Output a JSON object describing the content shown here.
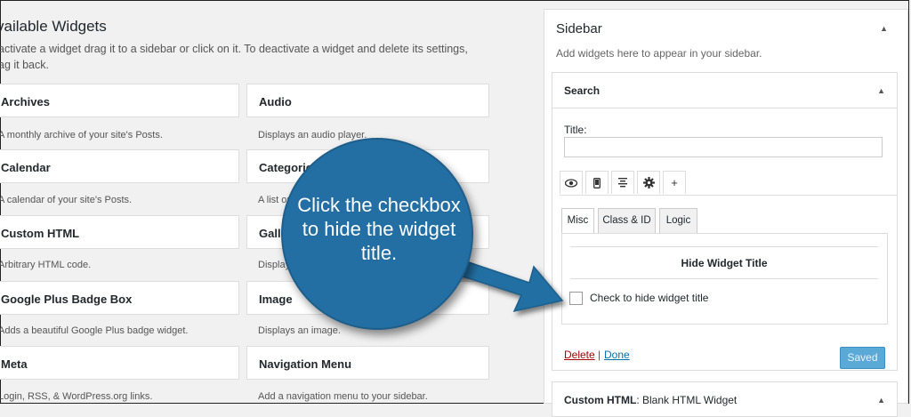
{
  "available": {
    "title": "vailable Widgets",
    "description": "activate a widget drag it to a sidebar or click on it. To deactivate a widget and delete its settings, ag it back."
  },
  "widgets": [
    {
      "name": "Archives",
      "desc": "A monthly archive of your site's Posts."
    },
    {
      "name": "Audio",
      "desc": "Displays an audio player."
    },
    {
      "name": "Calendar",
      "desc": "A calendar of your site's Posts."
    },
    {
      "name": "Categories",
      "desc": "A list or"
    },
    {
      "name": "Custom HTML",
      "desc": "Arbitrary HTML code."
    },
    {
      "name": "Galle",
      "desc": "Display"
    },
    {
      "name": "Google Plus Badge Box",
      "desc": "Adds a beautiful Google Plus badge widget."
    },
    {
      "name": "Image",
      "desc": "Displays an image."
    },
    {
      "name": "Meta",
      "desc": "Login, RSS, & WordPress.org links."
    },
    {
      "name": "Navigation Menu",
      "desc": "Add a navigation menu to your sidebar."
    }
  ],
  "sidebar": {
    "title": "Sidebar",
    "description": "Add widgets here to appear in your sidebar.",
    "toggle_icon": "triangle-up-icon"
  },
  "search_widget": {
    "title": "Search",
    "title_label": "Title:",
    "title_value": "",
    "icon_tabs": [
      "eye-icon",
      "mobile-icon",
      "align-icon",
      "gear-icon",
      "plus-icon"
    ],
    "text_tabs": [
      "Misc",
      "Class & ID",
      "Logic"
    ],
    "hide_header": "Hide Widget Title",
    "checkbox_label": "Check to hide widget title",
    "checkbox_checked": false,
    "delete_label": "Delete",
    "separator": "|",
    "done_label": "Done",
    "saved_label": "Saved"
  },
  "custom_widget": {
    "title_bold": "Custom HTML",
    "title_rest": ": Blank HTML Widget"
  },
  "callout": {
    "text": "Click the checkbox to hide the widget title.",
    "color": "#236fa3"
  }
}
